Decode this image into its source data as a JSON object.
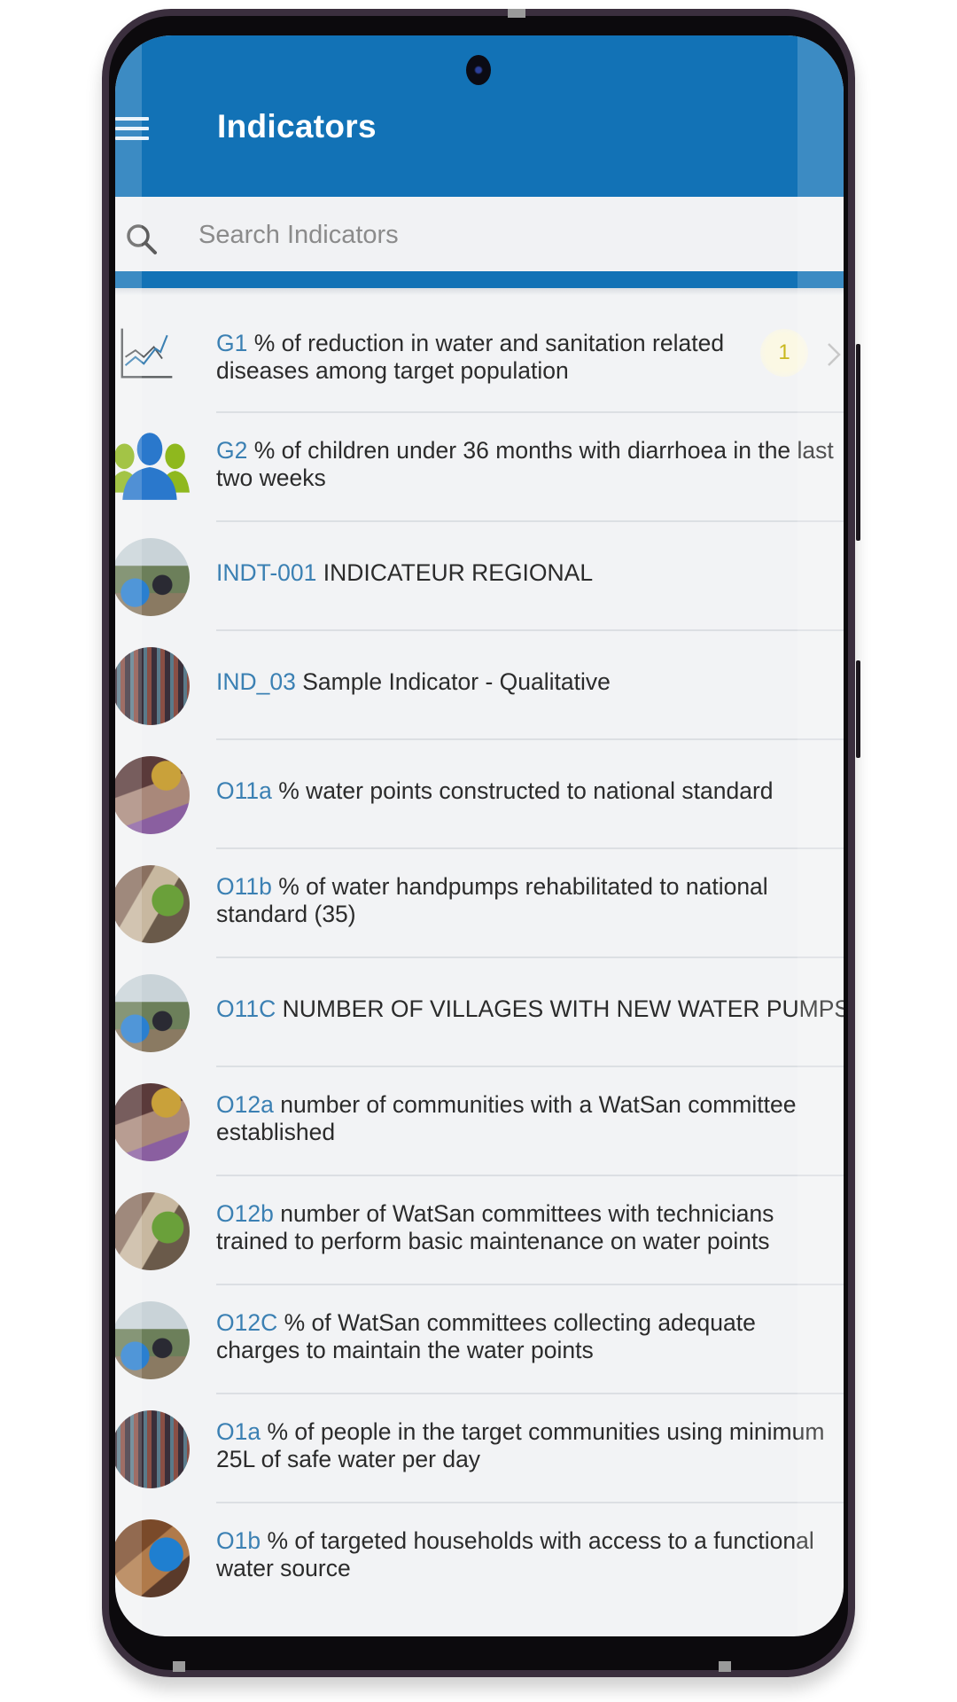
{
  "app": {
    "title": "Indicators",
    "header_color": "#1272b6",
    "code_color": "#3b80b3"
  },
  "header": {
    "menu_icon": "hamburger-menu-icon",
    "title": "Indicators"
  },
  "search": {
    "icon": "search-icon",
    "placeholder": "Search Indicators",
    "value": ""
  },
  "indicators": [
    {
      "code": "G1",
      "label": "% of reduction in water and sanitation related diseases among target population",
      "icon": "line-chart-icon",
      "badge": "1",
      "chevron": "chevron-right-icon"
    },
    {
      "code": "G2",
      "label": "% of children under 36 months with diarrhoea in the last two weeks",
      "icon": "users-group-icon"
    },
    {
      "code": "INDT-001",
      "label": "INDICATEUR REGIONAL",
      "icon": "photo-thumbnail-pump"
    },
    {
      "code": "IND_03",
      "label": "Sample Indicator - Qualitative",
      "icon": "photo-thumbnail-crowd"
    },
    {
      "code": "O11a",
      "label": "% water points constructed to national standard",
      "icon": "photo-thumbnail-market"
    },
    {
      "code": "O11b",
      "label": "% of water handpumps rehabilitated to national standard (35)",
      "icon": "photo-thumbnail-handpump"
    },
    {
      "code": "O11C",
      "label": "NUMBER OF VILLAGES WITH NEW WATER PUMPS",
      "icon": "photo-thumbnail-pump"
    },
    {
      "code": "O12a",
      "label": "number of communities with a WatSan committee established",
      "icon": "photo-thumbnail-market"
    },
    {
      "code": "O12b",
      "label": "number of WatSan committees with technicians trained to perform basic maintenance on water points",
      "icon": "photo-thumbnail-handpump"
    },
    {
      "code": "O12C",
      "label": "% of WatSan committees collecting adequate charges to maintain the water points",
      "icon": "photo-thumbnail-pump"
    },
    {
      "code": "O1a",
      "label": "% of people in the target communities using minimum 25L of safe water per day",
      "icon": "photo-thumbnail-crowd"
    },
    {
      "code": "O1b",
      "label": "% of targeted households with access to a functional water source",
      "icon": "photo-thumbnail-well"
    }
  ]
}
